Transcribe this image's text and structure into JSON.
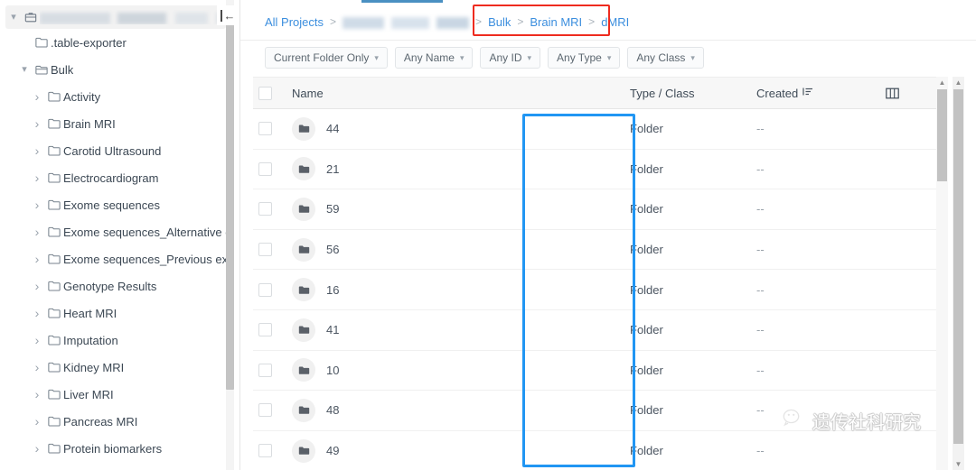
{
  "sidebar": {
    "root": {
      "label": "",
      "redacted": true,
      "icon": "briefcase-icon",
      "expanded": true
    },
    "items": [
      {
        "label": ".table-exporter",
        "depth": 1,
        "icon": "folder-icon",
        "chevron": "none"
      },
      {
        "label": "Bulk",
        "depth": 1,
        "icon": "folder-open-icon",
        "chevron": "down"
      },
      {
        "label": "Activity",
        "depth": 2,
        "icon": "folder-icon",
        "chevron": "right"
      },
      {
        "label": "Brain MRI",
        "depth": 2,
        "icon": "folder-icon",
        "chevron": "right"
      },
      {
        "label": "Carotid Ultrasound",
        "depth": 2,
        "icon": "folder-icon",
        "chevron": "right"
      },
      {
        "label": "Electrocardiogram",
        "depth": 2,
        "icon": "folder-icon",
        "chevron": "right"
      },
      {
        "label": "Exome sequences",
        "depth": 2,
        "icon": "folder-icon",
        "chevron": "right"
      },
      {
        "label": "Exome sequences_Alternative e",
        "depth": 2,
        "icon": "folder-icon",
        "chevron": "right"
      },
      {
        "label": "Exome sequences_Previous exc",
        "depth": 2,
        "icon": "folder-icon",
        "chevron": "right"
      },
      {
        "label": "Genotype Results",
        "depth": 2,
        "icon": "folder-icon",
        "chevron": "right"
      },
      {
        "label": "Heart MRI",
        "depth": 2,
        "icon": "folder-icon",
        "chevron": "right"
      },
      {
        "label": "Imputation",
        "depth": 2,
        "icon": "folder-icon",
        "chevron": "right"
      },
      {
        "label": "Kidney MRI",
        "depth": 2,
        "icon": "folder-icon",
        "chevron": "right"
      },
      {
        "label": "Liver MRI",
        "depth": 2,
        "icon": "folder-icon",
        "chevron": "right"
      },
      {
        "label": "Pancreas MRI",
        "depth": 2,
        "icon": "folder-icon",
        "chevron": "right"
      },
      {
        "label": "Protein biomarkers",
        "depth": 2,
        "icon": "folder-icon",
        "chevron": "right"
      }
    ],
    "collapse_button": "collapse-panel-icon"
  },
  "breadcrumb": {
    "all_projects": "All Projects",
    "project_redacted": true,
    "separator": ">",
    "trail": [
      "Bulk",
      "Brain MRI",
      "dMRI"
    ],
    "highlight_color": "#ee2b1f"
  },
  "filters": [
    {
      "label": "Current Folder Only",
      "caret": "chevron-down-icon"
    },
    {
      "label": "Any Name",
      "caret": "chevron-down-icon"
    },
    {
      "label": "Any ID",
      "caret": "chevron-down-icon"
    },
    {
      "label": "Any Type",
      "caret": "chevron-down-icon"
    },
    {
      "label": "Any Class",
      "caret": "chevron-down-icon"
    }
  ],
  "table": {
    "headers": {
      "name": "Name",
      "type_class": "Type / Class",
      "created": "Created",
      "sort_icon": "sort-descending-icon",
      "columns_icon": "columns-settings-icon"
    },
    "select_all_checked": false,
    "rows": [
      {
        "name": "44",
        "type": "Folder",
        "created": "--",
        "icon": "folder-icon",
        "checked": false
      },
      {
        "name": "21",
        "type": "Folder",
        "created": "--",
        "icon": "folder-icon",
        "checked": false
      },
      {
        "name": "59",
        "type": "Folder",
        "created": "--",
        "icon": "folder-icon",
        "checked": false
      },
      {
        "name": "56",
        "type": "Folder",
        "created": "--",
        "icon": "folder-icon",
        "checked": false
      },
      {
        "name": "16",
        "type": "Folder",
        "created": "--",
        "icon": "folder-icon",
        "checked": false
      },
      {
        "name": "41",
        "type": "Folder",
        "created": "--",
        "icon": "folder-icon",
        "checked": false
      },
      {
        "name": "10",
        "type": "Folder",
        "created": "--",
        "icon": "folder-icon",
        "checked": false
      },
      {
        "name": "48",
        "type": "Folder",
        "created": "--",
        "icon": "folder-icon",
        "checked": false
      },
      {
        "name": "49",
        "type": "Folder",
        "created": "--",
        "icon": "folder-icon",
        "checked": false
      }
    ],
    "name_highlight_color": "#2196f3"
  },
  "watermark": {
    "text": "遗传社科研究",
    "icon": "wechat-icon"
  },
  "tab_indicator_color": "#4a90c2"
}
